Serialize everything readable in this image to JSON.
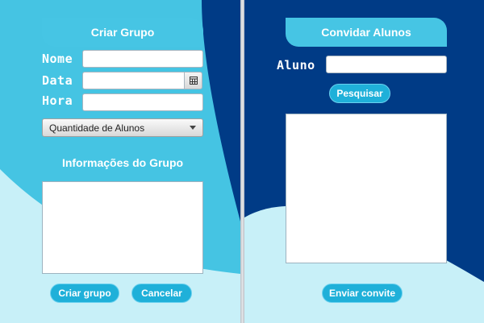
{
  "colors": {
    "dark_blue": "#003b86",
    "cyan": "#45c4e3",
    "light_cyan": "#c8f0f8",
    "button": "#1fb0d9",
    "tab": "#46c5e4"
  },
  "left": {
    "title": "Criar Grupo",
    "fields": {
      "nome_label": "Nome",
      "data_label": "Data",
      "hora_label": "Hora",
      "nome_value": "",
      "data_value": "",
      "hora_value": ""
    },
    "calendar_icon": "calendar-icon",
    "quantity_select": {
      "selected": "Quantidade de Alunos"
    },
    "info_heading": "Informações do Grupo",
    "info_value": "",
    "buttons": {
      "create": "Criar grupo",
      "cancel": "Cancelar"
    }
  },
  "right": {
    "title": "Convidar Alunos",
    "aluno_label": "Aluno",
    "aluno_value": "",
    "search_button": "Pesquisar",
    "results_value": "",
    "send_button": "Enviar convite"
  }
}
